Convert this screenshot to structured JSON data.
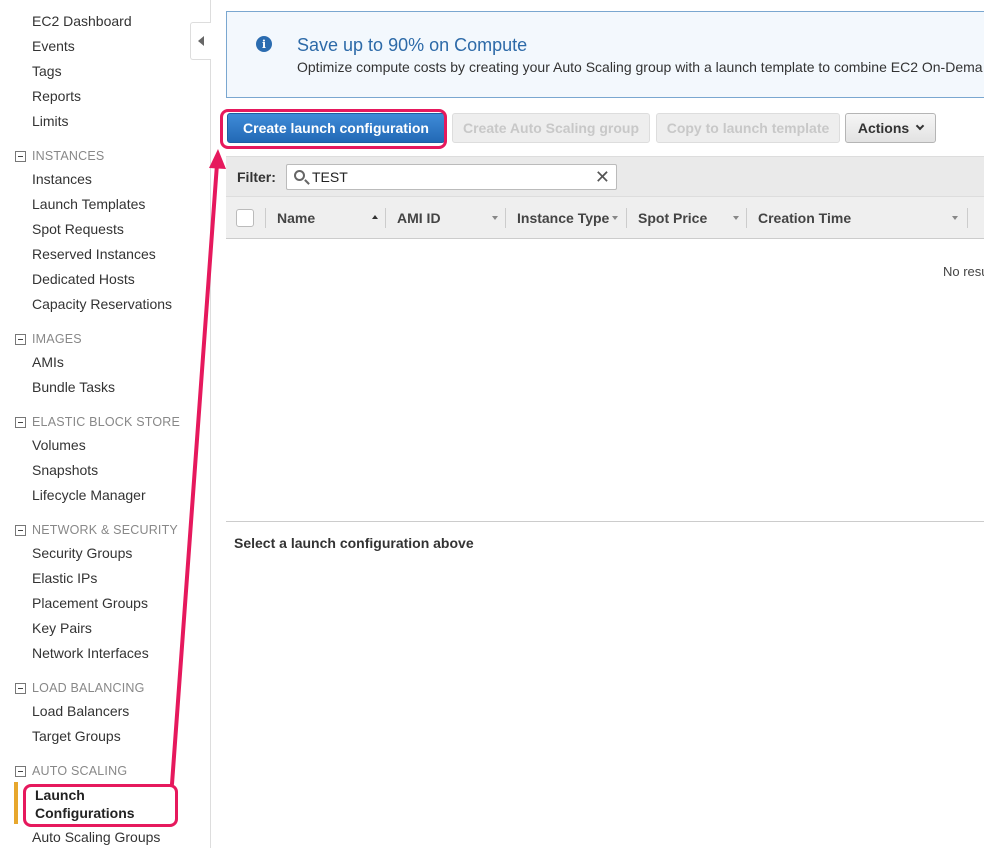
{
  "sidebar": {
    "top_items": [
      "EC2 Dashboard",
      "Events",
      "Tags",
      "Reports",
      "Limits"
    ],
    "sections": [
      {
        "title": "INSTANCES",
        "items": [
          "Instances",
          "Launch Templates",
          "Spot Requests",
          "Reserved Instances",
          "Dedicated Hosts",
          "Capacity Reservations"
        ]
      },
      {
        "title": "IMAGES",
        "items": [
          "AMIs",
          "Bundle Tasks"
        ]
      },
      {
        "title": "ELASTIC BLOCK STORE",
        "items": [
          "Volumes",
          "Snapshots",
          "Lifecycle Manager"
        ]
      },
      {
        "title": "NETWORK & SECURITY",
        "items": [
          "Security Groups",
          "Elastic IPs",
          "Placement Groups",
          "Key Pairs",
          "Network Interfaces"
        ]
      },
      {
        "title": "LOAD BALANCING",
        "items": [
          "Load Balancers",
          "Target Groups"
        ]
      },
      {
        "title": "AUTO SCALING",
        "items": [
          "Launch Configurations",
          "Auto Scaling Groups"
        ]
      }
    ],
    "active_item": "Launch Configurations"
  },
  "banner": {
    "title": "Save up to 90% on Compute",
    "description": "Optimize compute costs by creating your Auto Scaling group with a launch template to combine EC2 On-Dema"
  },
  "toolbar": {
    "create_label": "Create launch configuration",
    "asg_label": "Create Auto Scaling group",
    "copy_label": "Copy to launch template",
    "actions_label": "Actions"
  },
  "filter": {
    "label": "Filter:",
    "value": "TEST"
  },
  "table": {
    "columns": [
      "Name",
      "AMI ID",
      "Instance Type",
      "Spot Price",
      "Creation Time"
    ],
    "empty_text": "No resu"
  },
  "details": {
    "message": "Select a launch configuration above"
  },
  "colors": {
    "highlight": "#e6195d",
    "primary_button": "#2b78c8",
    "active_marker": "#e7a72d"
  }
}
